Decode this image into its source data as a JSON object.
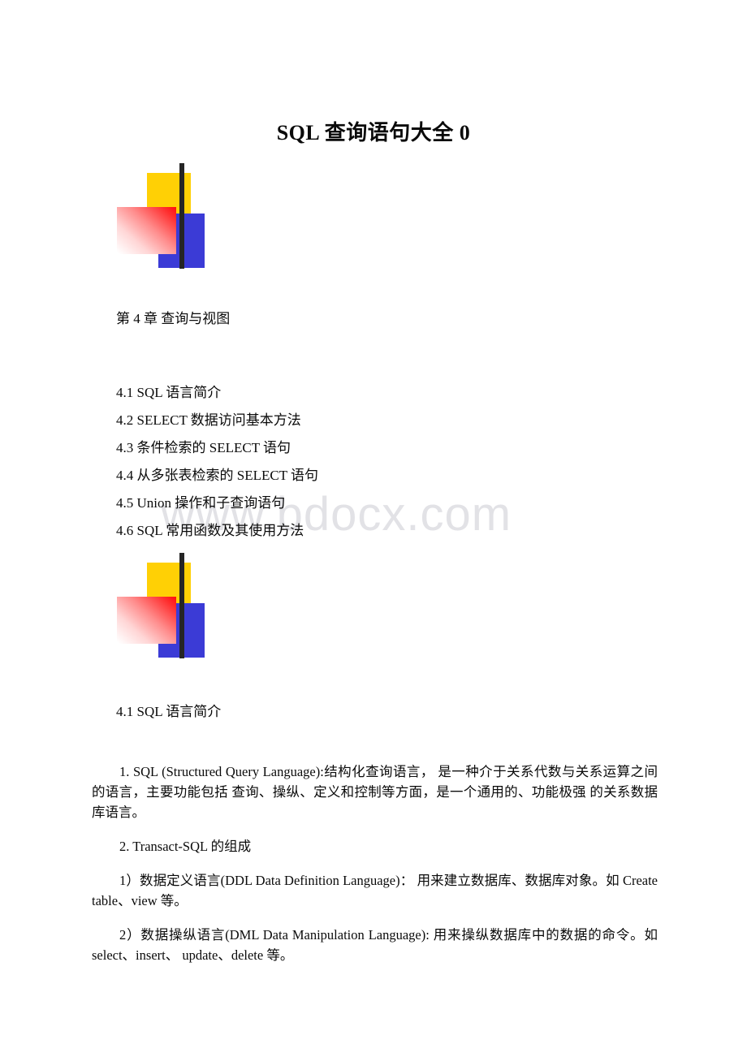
{
  "document": {
    "title": "SQL 查询语句大全 0",
    "chapter_heading": "第 4 章 查询与视图",
    "section_heading": "4.1 SQL 语言简介",
    "watermark": "www.bdocx.com"
  },
  "toc": {
    "items": [
      {
        "label": "4.1 SQL 语言简介"
      },
      {
        "label": "4.2 SELECT 数据访问基本方法"
      },
      {
        "label": "4.3 条件检索的 SELECT 语句"
      },
      {
        "label": "4.4 从多张表检索的 SELECT 语句"
      },
      {
        "label": "4.5 Union 操作和子查询语句"
      },
      {
        "label": "4.6 SQL 常用函数及其使用方法"
      }
    ]
  },
  "body": {
    "paragraphs": [
      {
        "text": "1. SQL (Structured Query Language):结构化查询语言， 是一种介于关系代数与关系运算之间的语言，主要功能包括 查询、操纵、定义和控制等方面，是一个通用的、功能极强 的关系数据库语言。"
      },
      {
        "text": "2. Transact-SQL 的组成"
      },
      {
        "text": "1）数据定义语言(DDL Data Definition Language)： 用来建立数据库、数据库对象。如 Create table、view 等。"
      },
      {
        "text": "2）数据操纵语言(DML Data Manipulation Language): 用来操纵数据库中的数据的命令。如 select、insert、 update、delete 等。"
      }
    ]
  },
  "logo": {
    "yellow": "#ffd005",
    "blue": "#3b3bd6",
    "red": "#ff0c0c",
    "bar": "#252525"
  }
}
